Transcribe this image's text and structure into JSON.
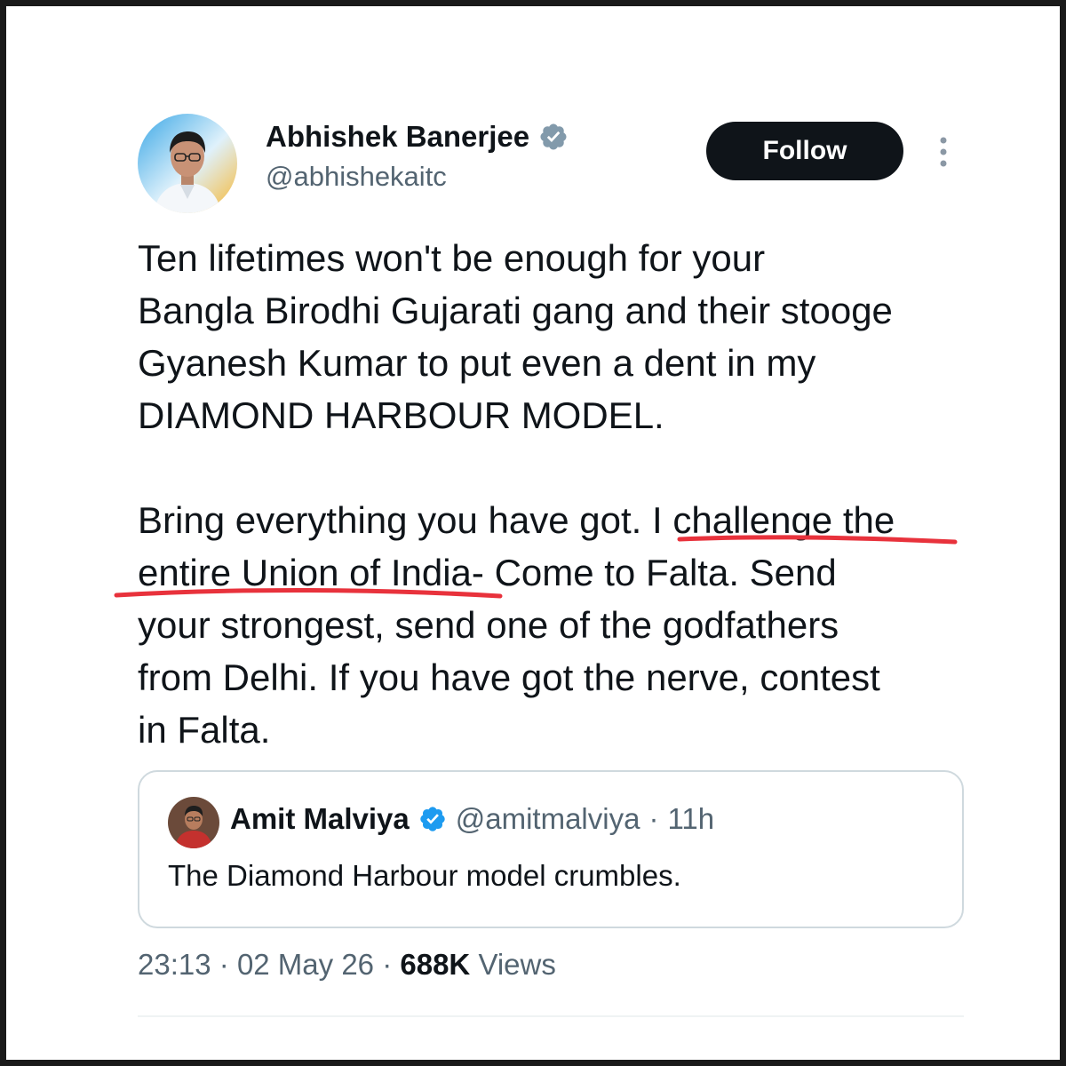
{
  "author": {
    "name": "Abhishek Banerjee",
    "handle": "@abhishekaitc",
    "verified": true,
    "avatar_icon": "profile-photo"
  },
  "follow_label": "Follow",
  "more_icon": "vertical-ellipsis-icon",
  "tweet_lines": [
    "Ten lifetimes won't be enough for your",
    "Bangla Birodhi Gujarati gang and their stooge",
    "Gyanesh Kumar to put even a dent in my",
    "DIAMOND HARBOUR MODEL.",
    "",
    "Bring everything you have got. I challenge the",
    "entire Union of India- Come to Falta. Send",
    "your strongest, send one of the godfathers",
    "from Delhi. If you have got the nerve, contest",
    "in Falta."
  ],
  "quoted": {
    "name": "Amit Malviya",
    "handle": "@amitmalviya",
    "separator": "·",
    "age": "11h",
    "text": "The Diamond Harbour model crumbles.",
    "verified": true
  },
  "meta": {
    "time": "23:13",
    "separator": "·",
    "date": "02 May 26",
    "views_count": "688K",
    "views_label": "Views"
  },
  "colors": {
    "text": "#0f1419",
    "secondary": "#536471",
    "verified_blue": "#1d9bf0",
    "verified_gray": "#829aab",
    "annotation_red": "#e8323c",
    "border": "#cfd9de"
  }
}
